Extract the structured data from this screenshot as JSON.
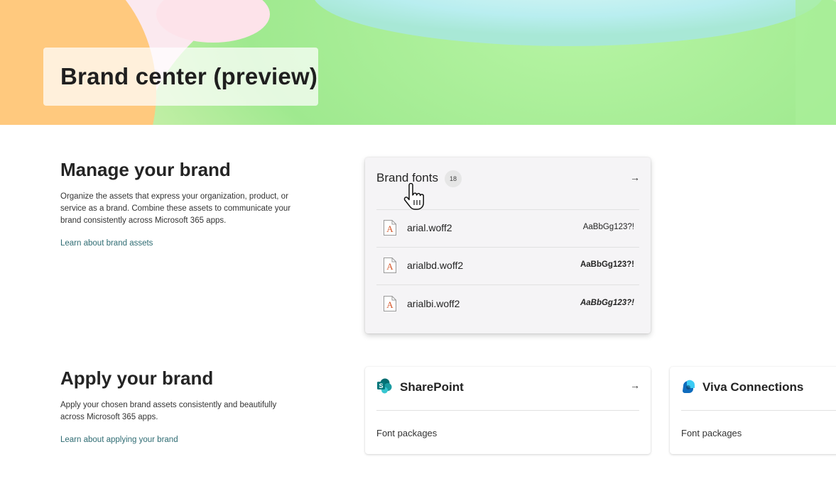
{
  "hero": {
    "title": "Brand center (preview)"
  },
  "manage": {
    "title": "Manage your brand",
    "description": "Organize the assets that express your organization, product, or service as a brand. Combine these assets to communicate your brand consistently across Microsoft 365 apps.",
    "link": "Learn about brand assets"
  },
  "apply": {
    "title": "Apply your brand",
    "description": "Apply your chosen brand assets consistently and beautifully across Microsoft 365 apps.",
    "link": "Learn about applying your brand"
  },
  "brand_fonts": {
    "title": "Brand fonts",
    "count": "18",
    "arrow": "→",
    "fonts": [
      {
        "name": "arial.woff2",
        "sample": "AaBbGg123?!"
      },
      {
        "name": "arialbd.woff2",
        "sample": "AaBbGg123?!"
      },
      {
        "name": "arialbi.woff2",
        "sample": "AaBbGg123?!"
      }
    ]
  },
  "sharepoint": {
    "title": "SharePoint",
    "subtitle": "Font packages",
    "arrow": "→"
  },
  "viva": {
    "title": "Viva Connections",
    "subtitle": "Font packages"
  },
  "colors": {
    "link": "#2f6c73",
    "sharepoint_brand": "#03787c",
    "viva_brand": "#0f6cbd",
    "file_icon_accent": "#d5582c"
  },
  "icons": {
    "font_file": "font-file-icon",
    "sharepoint": "sharepoint-logo-icon",
    "viva": "viva-connections-logo-icon",
    "arrow": "arrow-right-icon",
    "cursor": "hand-pointer-cursor"
  }
}
